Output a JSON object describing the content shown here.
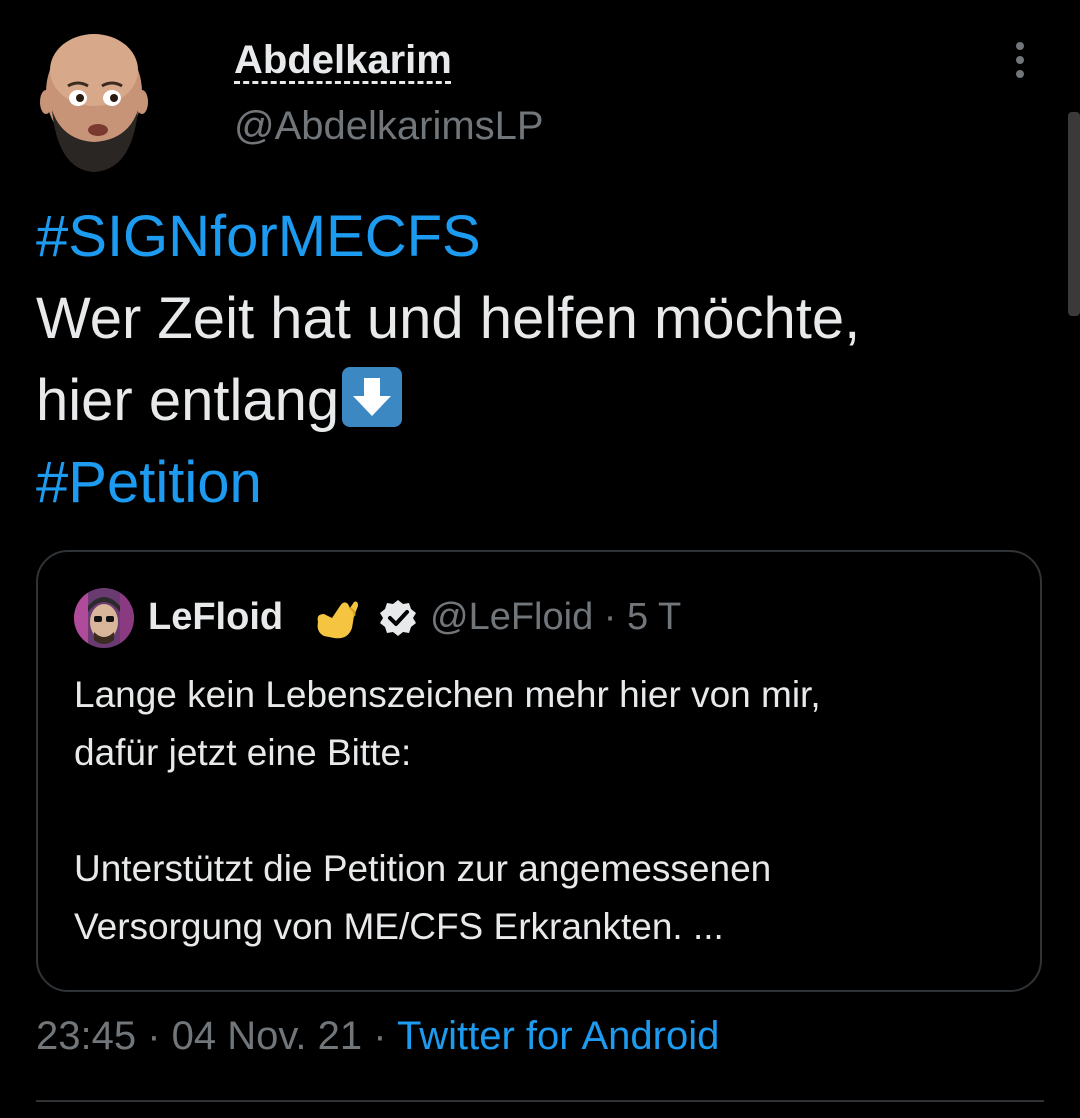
{
  "author": {
    "name": "Abdelkarim",
    "handle": "@AbdelkarimsLP"
  },
  "tweet": {
    "hashtag1": "#SIGNforMECFS",
    "line1": "Wer Zeit hat und helfen möchte,",
    "line2": "hier entlang",
    "hashtag2": "#Petition",
    "emoji": "down-arrow-emoji"
  },
  "quote": {
    "name": "LeFloid",
    "handle_time": "@LeFloid · 5 T",
    "lines": [
      "Lange kein Lebenszeichen mehr hier von mir,",
      "dafür jetzt eine Bitte:",
      "Unterstützt die Petition zur angemessenen",
      "Versorgung von ME/CFS Erkrankten. ..."
    ]
  },
  "meta": {
    "time": "23:45",
    "sep1": " · ",
    "date": "04 Nov. 21",
    "sep2": " · ",
    "source": "Twitter for Android"
  },
  "colors": {
    "background": "#000000",
    "text": "#e7e9ea",
    "secondary": "#71767b",
    "link": "#1d9bf0",
    "border": "#2f3336"
  }
}
